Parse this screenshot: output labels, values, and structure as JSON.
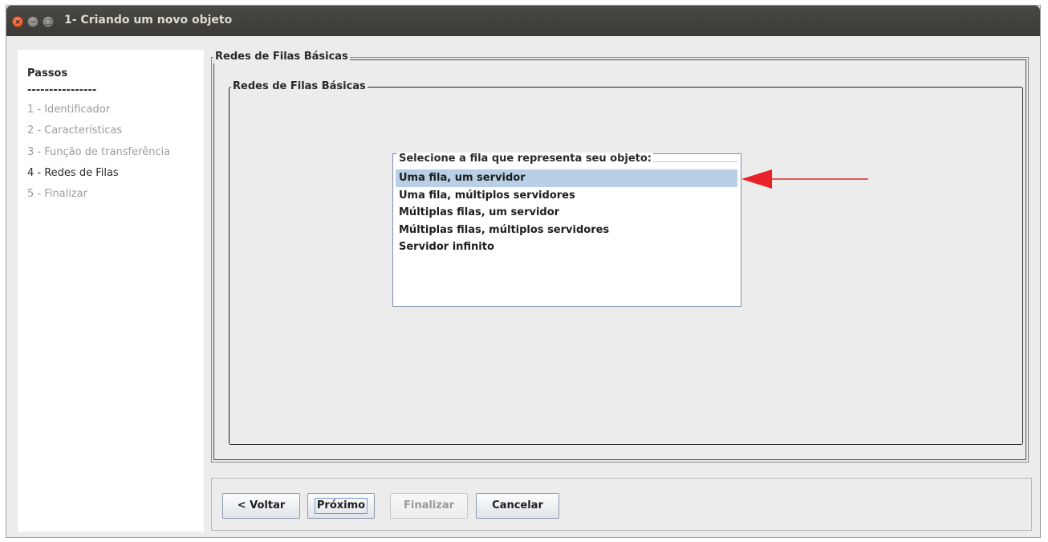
{
  "window": {
    "title": "1- Criando um novo objeto",
    "controls": {
      "close": "×",
      "minimize": "−",
      "maximize": "□"
    }
  },
  "sidebar": {
    "heading": "Passos",
    "separator": "----------------",
    "steps": [
      {
        "label": "1 - Identificador",
        "active": false
      },
      {
        "label": "2 - Características",
        "active": false
      },
      {
        "label": "3 - Função de transferência",
        "active": false
      },
      {
        "label": "4 - Redes de Filas",
        "active": true
      },
      {
        "label": "5 - Finalizar",
        "active": false
      }
    ]
  },
  "main": {
    "outer_title": "Redes de Filas Básicas",
    "inner_title": "Redes de Filas Básicas",
    "list": {
      "title": "Selecione a fila que representa seu objeto:",
      "items": [
        "Uma fila, um servidor",
        "Uma fila, múltiplos servidores",
        "Múltiplas filas, um servidor",
        "Múltiplas filas, múltiplos servidores",
        "Servidor infinito"
      ],
      "selected_index": 0
    },
    "annotation_arrow_color": "#e8232a"
  },
  "buttons": {
    "back": "< Voltar",
    "next": "Próximo",
    "finish": "Finalizar",
    "cancel": "Cancelar"
  },
  "colors": {
    "selection": "#b8cfe5",
    "title_bar": "#3c3b37",
    "close_button": "#e9592d"
  }
}
